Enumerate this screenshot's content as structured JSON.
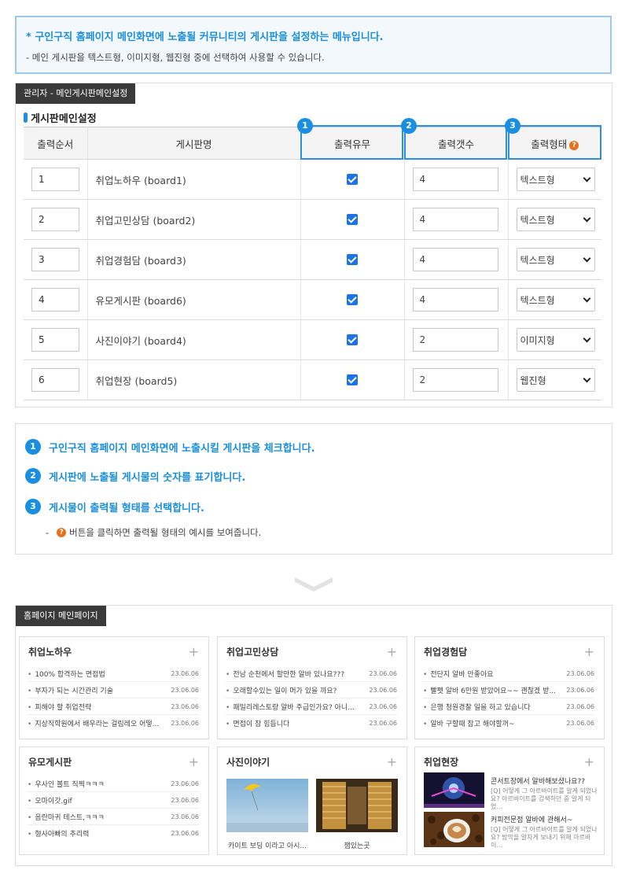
{
  "info": {
    "title": "* 구인구직 홈페이지 메인화면에 노출될 커뮤니티의 게시판을 설정하는 메뉴입니다.",
    "desc": "- 메인 게시판을 텍스트형, 이미지형, 웹진형 중에 선택하여 사용할 수 있습니다."
  },
  "settings": {
    "tag": "관리자 - 메인게시판메인설정",
    "section_title": "게시판메인설정",
    "headers": {
      "order": "출력순서",
      "name": "게시판명",
      "show": "출력유무",
      "count": "출력갯수",
      "type": "출력형태"
    },
    "badges": [
      "1",
      "2",
      "3"
    ],
    "rows": [
      {
        "order": "1",
        "name": "취업노하우 (board1)",
        "checked": true,
        "count": "4",
        "type": "텍스트형"
      },
      {
        "order": "2",
        "name": "취업고민상담 (board2)",
        "checked": true,
        "count": "4",
        "type": "텍스트형"
      },
      {
        "order": "3",
        "name": "취업경험담 (board3)",
        "checked": true,
        "count": "4",
        "type": "텍스트형"
      },
      {
        "order": "4",
        "name": "유모게시판 (board6)",
        "checked": true,
        "count": "4",
        "type": "텍스트형"
      },
      {
        "order": "5",
        "name": "사진이야기 (board4)",
        "checked": true,
        "count": "2",
        "type": "이미지형"
      },
      {
        "order": "6",
        "name": "취업현장 (board5)",
        "checked": true,
        "count": "2",
        "type": "웹진형"
      }
    ]
  },
  "notes": {
    "n1": "구인구직 홈페이지 메인화면에 노출시킬 게시판을 체크합니다.",
    "n2": "게시판에 노출될 게시물의 숫자를 표기합니다.",
    "n3": "게시물이 출력될 형태를 선택합니다.",
    "sub_prefix": "-",
    "sub": "버튼을 클릭하면 출력될 형태의 예시를 보여줍니다."
  },
  "homepage": {
    "tag": "홈페이지 메인페이지",
    "plus": "+",
    "boards": [
      {
        "title": "취업노하우",
        "items": [
          {
            "text": "100% 합격하는 면접법",
            "date": "23.06.06"
          },
          {
            "text": "부자가 되는 시간관리 기술",
            "date": "23.06.06"
          },
          {
            "text": "피해야 할 취업전략",
            "date": "23.06.06"
          },
          {
            "text": "지상직학원에서 배우라는 걸림레오 어떻...",
            "date": "23.06.06"
          }
        ]
      },
      {
        "title": "취업고민상담",
        "items": [
          {
            "text": "전남 순천에서 할만한 알바 있나요???",
            "date": "23.06.06"
          },
          {
            "text": "오래할수있는 일이 머가 있을 까요?",
            "date": "23.06.06"
          },
          {
            "text": "패밀리레스토랑 알바 주급인가요? 아니...",
            "date": "23.06.06"
          },
          {
            "text": "면접이 참 힘듭니다",
            "date": "23.06.06"
          }
        ]
      },
      {
        "title": "취업경험담",
        "items": [
          {
            "text": "전단지 알바 안좋아요",
            "date": "23.06.06"
          },
          {
            "text": "빨펫 알바 6만원 받았어요~~ 괜찮겠 받...",
            "date": "23.06.06"
          },
          {
            "text": "은행 청원경찰 일을 하고 있습니다",
            "date": "23.06.06"
          },
          {
            "text": "알바 구할때 참고 해야할꺼~",
            "date": "23.06.06"
          }
        ]
      },
      {
        "title": "유모게시판",
        "items": [
          {
            "text": "우사인 볼트 직찍ㅋㅋㅋ",
            "date": "23.06.06"
          },
          {
            "text": "오마이갓.gif",
            "date": "23.06.06"
          },
          {
            "text": "음란마귀 테스트,ㅋㅋㅋ",
            "date": "23.06.06"
          },
          {
            "text": "형사아빠의 추리력",
            "date": "23.06.06"
          }
        ]
      }
    ],
    "photo": {
      "title": "사진이야기",
      "captions": [
        "카이트 보딩 이라고 아시...",
        "잼있는곳"
      ]
    },
    "webzine": {
      "title": "취업현장",
      "items": [
        {
          "title": "콘서트장에서 알바해보셨나요??",
          "desc": "[Q] 어떻게 그 아르바이트를 알게 되었나요? 아르바이트를 검색하던 중 알게 되었..."
        },
        {
          "title": "커피전문점 알바에 관해서~",
          "desc": "[Q] 어떻게 그 아르바이트를 알게 되었나요? 밤막을 알차게 보내기 위해 아르바이..."
        }
      ]
    }
  }
}
